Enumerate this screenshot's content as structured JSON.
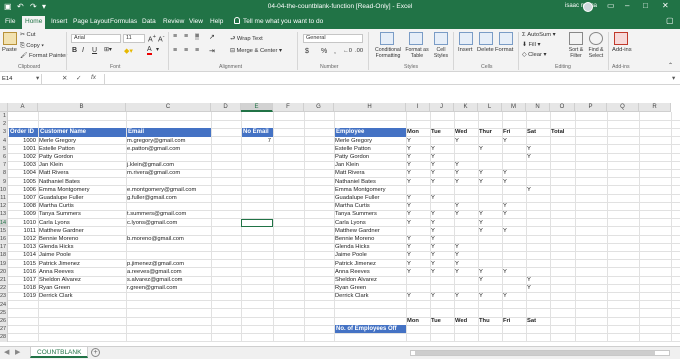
{
  "window": {
    "title": "04-04-the-countblank-function  [Read-Only]  -  Excel",
    "user": "isaac maina"
  },
  "ribbon_tabs": [
    "File",
    "Home",
    "Insert",
    "Page Layout",
    "Formulas",
    "Data",
    "Review",
    "View",
    "Help"
  ],
  "tell_me": "Tell me what you want to do",
  "ribbon": {
    "clipboard": {
      "paste": "Paste",
      "cut": "Cut",
      "copy": "Copy",
      "format_painter": "Format Painter",
      "group": "Clipboard"
    },
    "font": {
      "name": "Arial",
      "size": "11",
      "bold": "B",
      "italic": "I",
      "underline": "U",
      "group": "Font"
    },
    "alignment": {
      "wrap": "Wrap Text",
      "merge": "Merge & Center",
      "group": "Alignment"
    },
    "number": {
      "format": "General",
      "currency": "$",
      "percent": "%",
      "comma": ",",
      "group": "Number"
    },
    "styles": {
      "cond": "Conditional Formatting",
      "table": "Format as Table",
      "cell": "Cell Styles",
      "group": "Styles"
    },
    "cells": {
      "insert": "Insert",
      "delete": "Delete",
      "format": "Format",
      "group": "Cells"
    },
    "editing": {
      "autosum": "AutoSum",
      "fill": "Fill",
      "clear": "Clear",
      "sort": "Sort & Filter",
      "find": "Find & Select",
      "group": "Editing"
    },
    "addins": {
      "label": "Add-ins",
      "group": "Add-ins"
    }
  },
  "formula_bar": {
    "name_box": "E14",
    "fx": "fx",
    "cancel": "✕",
    "enter": "✓",
    "value": ""
  },
  "columns": [
    "A",
    "B",
    "C",
    "D",
    "E",
    "F",
    "G",
    "H",
    "I",
    "J",
    "K",
    "L",
    "M",
    "N",
    "O",
    "P",
    "Q",
    "R"
  ],
  "rows": [
    "1",
    "2",
    "3",
    "4",
    "5",
    "6",
    "7",
    "8",
    "9",
    "10",
    "11",
    "12",
    "13",
    "14",
    "15",
    "16",
    "17",
    "18",
    "19",
    "20",
    "21",
    "22",
    "23",
    "24",
    "25",
    "26",
    "27",
    "28"
  ],
  "headers": {
    "order_id": "Order ID",
    "customer": "Customer Name",
    "email": "Email",
    "no_email": "No Email",
    "employee": "Employee",
    "total": "Total"
  },
  "no_email_value": "7",
  "days": [
    "Mon",
    "Tue",
    "Wed",
    "Thur",
    "Fri",
    "Sat"
  ],
  "orders": [
    {
      "id": "1000",
      "name": "Merle Gregory",
      "email": "m.gregory@gmail.com"
    },
    {
      "id": "1001",
      "name": "Estelle Patton",
      "email": "e.patton@gmail.com"
    },
    {
      "id": "1002",
      "name": "Patty Gordon",
      "email": ""
    },
    {
      "id": "1003",
      "name": "Jan Klein",
      "email": "j.klein@gmail.com"
    },
    {
      "id": "1004",
      "name": "Matt Rivera",
      "email": "m.rivera@gmail.com"
    },
    {
      "id": "1005",
      "name": "Nathaniel Bates",
      "email": ""
    },
    {
      "id": "1006",
      "name": "Emma Montgomery",
      "email": "e.montgomery@gmail.com"
    },
    {
      "id": "1007",
      "name": "Guadalupe Fuller",
      "email": "g.fuller@gmail.com"
    },
    {
      "id": "1008",
      "name": "Martha Curtis",
      "email": ""
    },
    {
      "id": "1009",
      "name": "Tanya Summers",
      "email": "t.summers@gmail.com"
    },
    {
      "id": "1010",
      "name": "Carla Lyons",
      "email": "c.lyons@gmail.com"
    },
    {
      "id": "1011",
      "name": "Matthew Gardner",
      "email": ""
    },
    {
      "id": "1012",
      "name": "Bennie Moreno",
      "email": "b.moreno@gmail.com"
    },
    {
      "id": "1013",
      "name": "Glenda Hicks",
      "email": ""
    },
    {
      "id": "1014",
      "name": "Jaime Poole",
      "email": ""
    },
    {
      "id": "1015",
      "name": "Patrick Jimenez",
      "email": "p.jimenez@gmail.com"
    },
    {
      "id": "1016",
      "name": "Anna Reeves",
      "email": "a.reeves@gmail.com"
    },
    {
      "id": "1017",
      "name": "Sheldon Alvarez",
      "email": "s.alvarez@gmail.com"
    },
    {
      "id": "1018",
      "name": "Ryan Green",
      "email": "r.green@gmail.com"
    },
    {
      "id": "1019",
      "name": "Derrick Clark",
      "email": ""
    }
  ],
  "schedule": [
    {
      "name": "Merle Gregory",
      "marks": [
        "Y",
        "",
        "Y",
        "",
        "Y",
        ""
      ]
    },
    {
      "name": "Estelle Patton",
      "marks": [
        "Y",
        "Y",
        "",
        "Y",
        "",
        "Y"
      ]
    },
    {
      "name": "Patty Gordon",
      "marks": [
        "Y",
        "Y",
        "",
        "",
        "",
        "Y"
      ]
    },
    {
      "name": "Jan Klein",
      "marks": [
        "Y",
        "Y",
        "Y",
        "",
        "",
        ""
      ]
    },
    {
      "name": "Matt Rivera",
      "marks": [
        "Y",
        "Y",
        "Y",
        "Y",
        "Y",
        ""
      ]
    },
    {
      "name": "Nathaniel Bates",
      "marks": [
        "Y",
        "Y",
        "Y",
        "Y",
        "Y",
        ""
      ]
    },
    {
      "name": "Emma Montgomery",
      "marks": [
        "",
        "",
        "",
        "",
        "",
        "Y"
      ]
    },
    {
      "name": "Guadalupe Fuller",
      "marks": [
        "Y",
        "Y",
        "",
        "",
        "",
        ""
      ]
    },
    {
      "name": "Martha Curtis",
      "marks": [
        "Y",
        "",
        "Y",
        "",
        "Y",
        ""
      ]
    },
    {
      "name": "Tanya Summers",
      "marks": [
        "Y",
        "Y",
        "Y",
        "Y",
        "Y",
        ""
      ]
    },
    {
      "name": "Carla Lyons",
      "marks": [
        "Y",
        "Y",
        "",
        "Y",
        "",
        ""
      ]
    },
    {
      "name": "Matthew Gardner",
      "marks": [
        "",
        "Y",
        "",
        "Y",
        "Y",
        ""
      ]
    },
    {
      "name": "Bennie Moreno",
      "marks": [
        "Y",
        "Y",
        "",
        "",
        "",
        ""
      ]
    },
    {
      "name": "Glenda Hicks",
      "marks": [
        "Y",
        "Y",
        "Y",
        "",
        "",
        ""
      ]
    },
    {
      "name": "Jaime Poole",
      "marks": [
        "Y",
        "Y",
        "Y",
        "",
        "",
        ""
      ]
    },
    {
      "name": "Patrick Jimenez",
      "marks": [
        "Y",
        "Y",
        "Y",
        "",
        "",
        ""
      ]
    },
    {
      "name": "Anna Reeves",
      "marks": [
        "Y",
        "Y",
        "Y",
        "Y",
        "Y",
        ""
      ]
    },
    {
      "name": "Sheldon Alvarez",
      "marks": [
        "",
        "",
        "",
        "Y",
        "",
        "Y"
      ]
    },
    {
      "name": "Ryan Green",
      "marks": [
        "",
        "",
        "",
        "",
        "",
        "Y"
      ]
    },
    {
      "name": "Derrick Clark",
      "marks": [
        "Y",
        "Y",
        "Y",
        "Y",
        "Y",
        ""
      ]
    }
  ],
  "footer_days": [
    "Mon",
    "Tue",
    "Wed",
    "Thu",
    "Fri",
    "Sat"
  ],
  "employees_off_label": "No. of Employees Off",
  "sheet_tab": "COUNTBLANK",
  "colors": {
    "excel_green": "#217346",
    "header_blue": "#4472c4"
  }
}
